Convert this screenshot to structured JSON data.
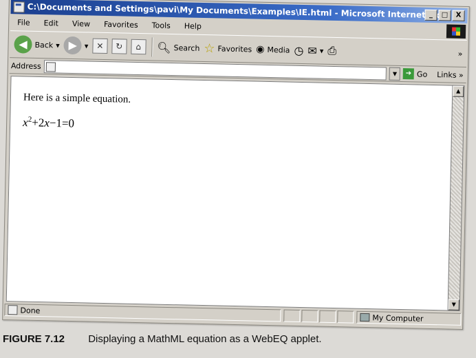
{
  "window": {
    "title": "C:\\Documents and Settings\\pavi\\My Documents\\Examples\\IE.html - Microsoft Internet Ex...",
    "buttons": [
      "_",
      "□",
      "X"
    ]
  },
  "menu": [
    "File",
    "Edit",
    "View",
    "Favorites",
    "Tools",
    "Help"
  ],
  "toolbar": {
    "back_label": "Back",
    "search_label": "Search",
    "favorites_label": "Favorites",
    "media_label": "Media"
  },
  "address": {
    "label": "Address",
    "value": "",
    "go_label": "Go",
    "links_label": "Links"
  },
  "content": {
    "text": "Here is a simple equation.",
    "equation": {
      "base": "x",
      "exponent": "2",
      "rest_a": "+2",
      "var": "x",
      "rest_b": "−1=0"
    }
  },
  "status": {
    "left": "Done",
    "zone": "My Computer"
  },
  "caption": {
    "figure": "FIGURE 7.12",
    "text": "Displaying a MathML equation as a WebEQ applet."
  }
}
